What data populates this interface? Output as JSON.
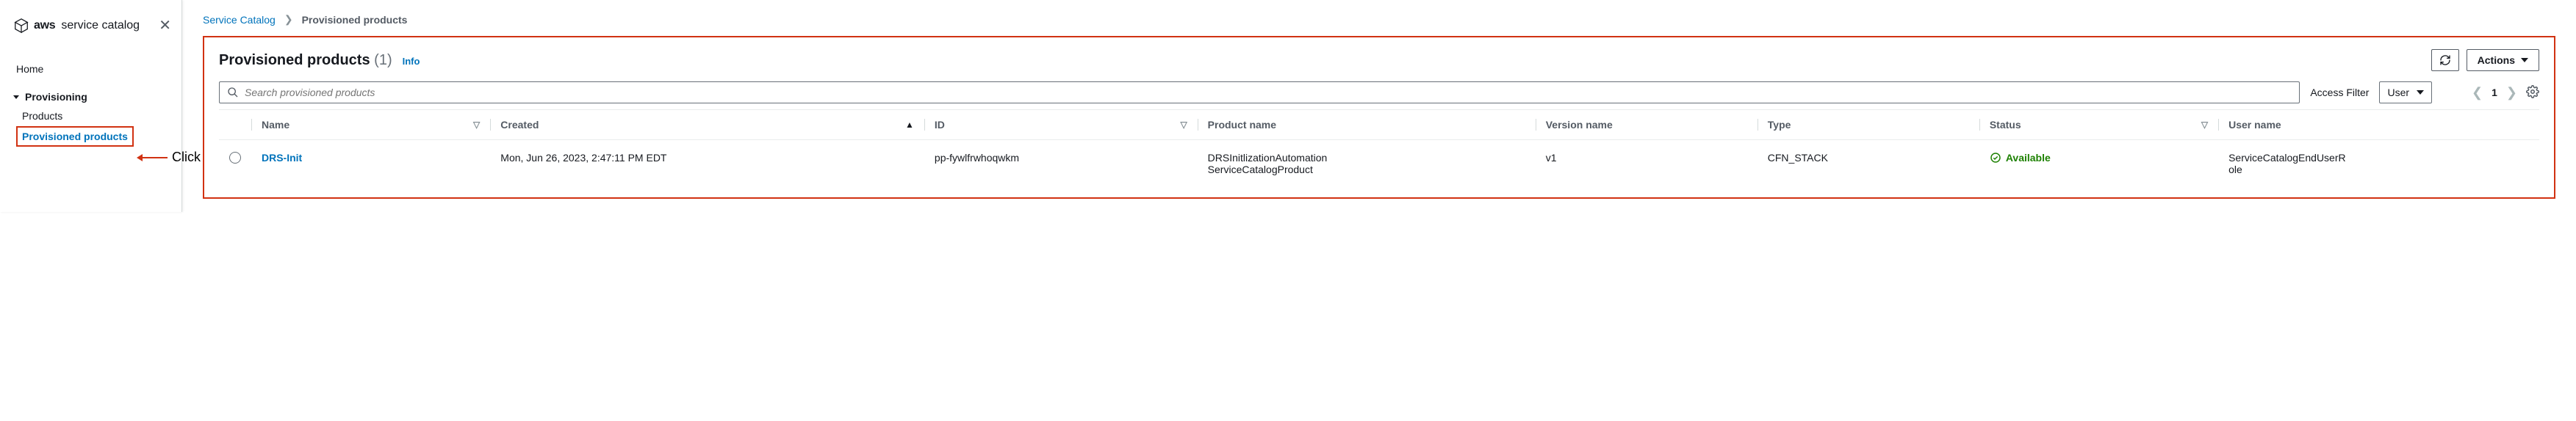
{
  "sidebar": {
    "brand_aws": "aws",
    "brand_service": "service catalog",
    "nav_home": "Home",
    "nav_provisioning": "Provisioning",
    "nav_products": "Products",
    "nav_provisioned": "Provisioned products"
  },
  "annotation": {
    "click_label": "Click"
  },
  "breadcrumb": {
    "root": "Service Catalog",
    "current": "Provisioned products"
  },
  "panel": {
    "title": "Provisioned products",
    "count": "(1)",
    "info": "Info",
    "actions_label": "Actions"
  },
  "toolbar": {
    "search_placeholder": "Search provisioned products",
    "access_filter_label": "Access Filter",
    "access_filter_value": "User",
    "page_number": "1"
  },
  "columns": {
    "name": "Name",
    "created": "Created",
    "id": "ID",
    "product": "Product name",
    "version": "Version name",
    "type": "Type",
    "status": "Status",
    "user": "User name"
  },
  "rows": [
    {
      "name": "DRS-Init",
      "created": "Mon, Jun 26, 2023, 2:47:11 PM EDT",
      "id": "pp-fywlfrwhoqwkm",
      "product": "DRSInitlizationAutomationServiceCatalogProduct",
      "version": "v1",
      "type": "CFN_STACK",
      "status": "Available",
      "user": "ServiceCatalogEndUserRole"
    }
  ]
}
